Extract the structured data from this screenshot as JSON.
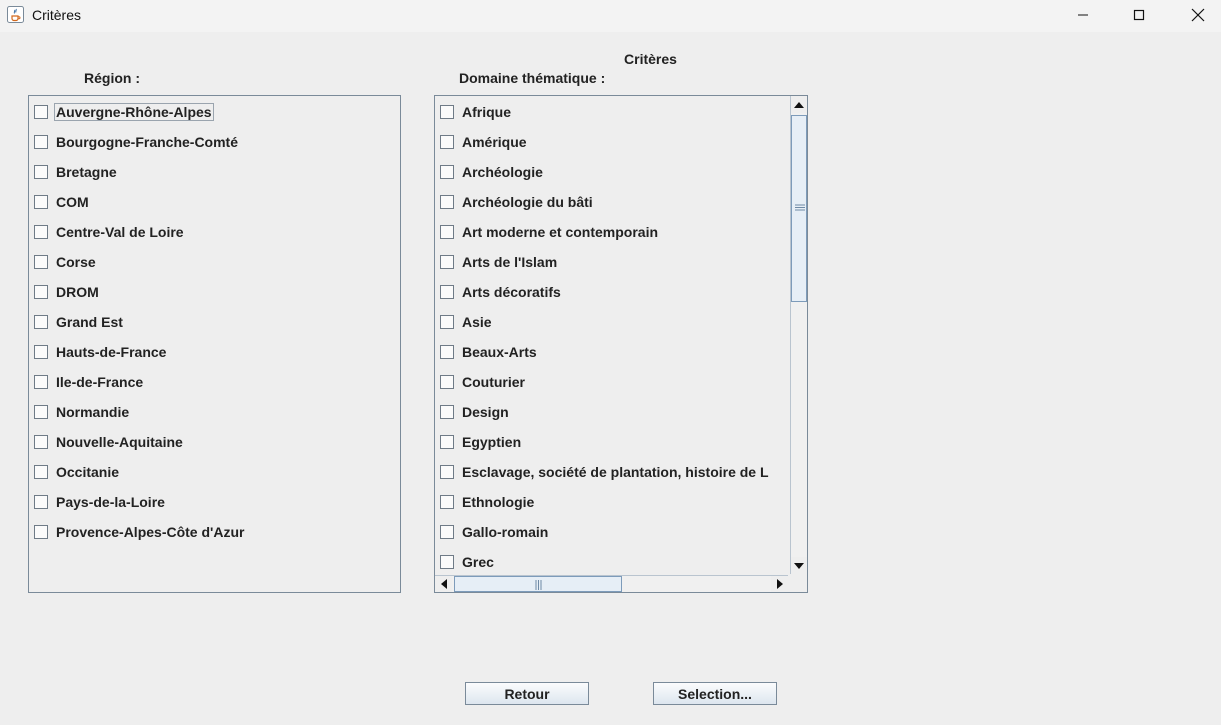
{
  "window": {
    "title": "Critères"
  },
  "page": {
    "title": "Critères",
    "region_label": "Région :",
    "domaine_label": "Domaine thématique :"
  },
  "regions": [
    "Auvergne-Rhône-Alpes",
    "Bourgogne-Franche-Comté",
    "Bretagne",
    "COM",
    "Centre-Val de Loire",
    "Corse",
    "DROM",
    "Grand Est",
    "Hauts-de-France",
    "Ile-de-France",
    "Normandie",
    "Nouvelle-Aquitaine",
    "Occitanie",
    "Pays-de-la-Loire",
    "Provence-Alpes-Côte d'Azur"
  ],
  "domaines": [
    "Afrique",
    "Amérique",
    "Archéologie",
    "Archéologie du bâti",
    "Art moderne et contemporain",
    "Arts de l'Islam",
    "Arts décoratifs",
    "Asie",
    "Beaux-Arts",
    "Couturier",
    "Design",
    "Egyptien",
    "Esclavage, société de plantation, histoire de L",
    "Ethnologie",
    "Gallo-romain",
    "Grec"
  ],
  "buttons": {
    "retour": "Retour",
    "selection": "Selection..."
  },
  "colors": {
    "background": "#eeeeee",
    "border": "#7a8a99",
    "scroll_thumb": "#e6eef6"
  }
}
